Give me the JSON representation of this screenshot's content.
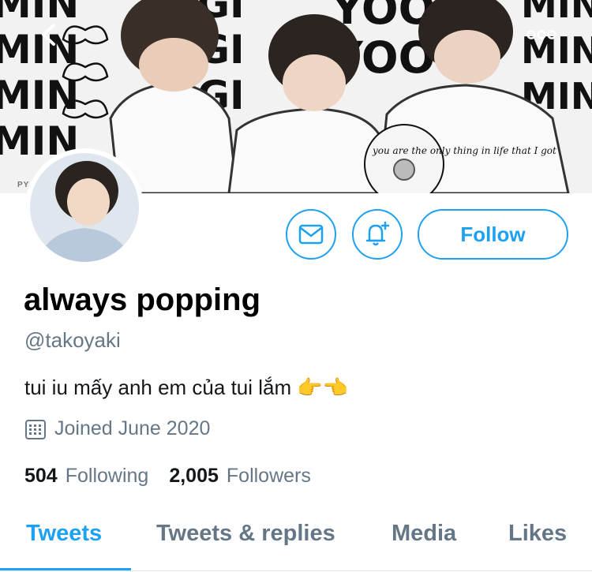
{
  "header": {
    "back_icon": "chevron-left-icon",
    "more_icon": "ellipsis-icon",
    "watermark": "PY",
    "banner_words": [
      "MIN",
      "GI",
      "YOO"
    ],
    "cd_text": "you are the only thing in life that I got"
  },
  "profile": {
    "display_name": "always popping",
    "handle": "@takoyaki",
    "bio": "tui iu mấy anh em của tui lắm 👉👈",
    "joined": "Joined June 2020",
    "following_count": "504",
    "following_label": "Following",
    "followers_count": "2,005",
    "followers_label": "Followers"
  },
  "actions": {
    "message_icon": "envelope-icon",
    "notify_icon": "bell-plus-icon",
    "follow_label": "Follow"
  },
  "tabs": [
    {
      "label": "Tweets",
      "active": true
    },
    {
      "label": "Tweets & replies",
      "active": false
    },
    {
      "label": "Media",
      "active": false
    },
    {
      "label": "Likes",
      "active": false
    }
  ],
  "colors": {
    "accent": "#1da1f2",
    "secondary_text": "#657786",
    "primary_text": "#14171a"
  }
}
